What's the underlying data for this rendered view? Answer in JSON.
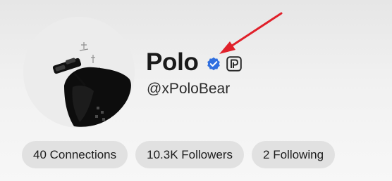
{
  "profile": {
    "name": "Polo",
    "handle": "@xPoloBear",
    "verified_badge_icon": "verified-check-icon",
    "premium_icon": "p-logo-icon",
    "avatar_icon": "avatar-image"
  },
  "stats": {
    "connections": "40 Connections",
    "followers": "10.3K Followers",
    "following": "2 Following"
  },
  "colors": {
    "verified_badge": "#2f6fe0",
    "annotation_arrow": "#e0202a",
    "pill_background": "#e1e1e1"
  }
}
